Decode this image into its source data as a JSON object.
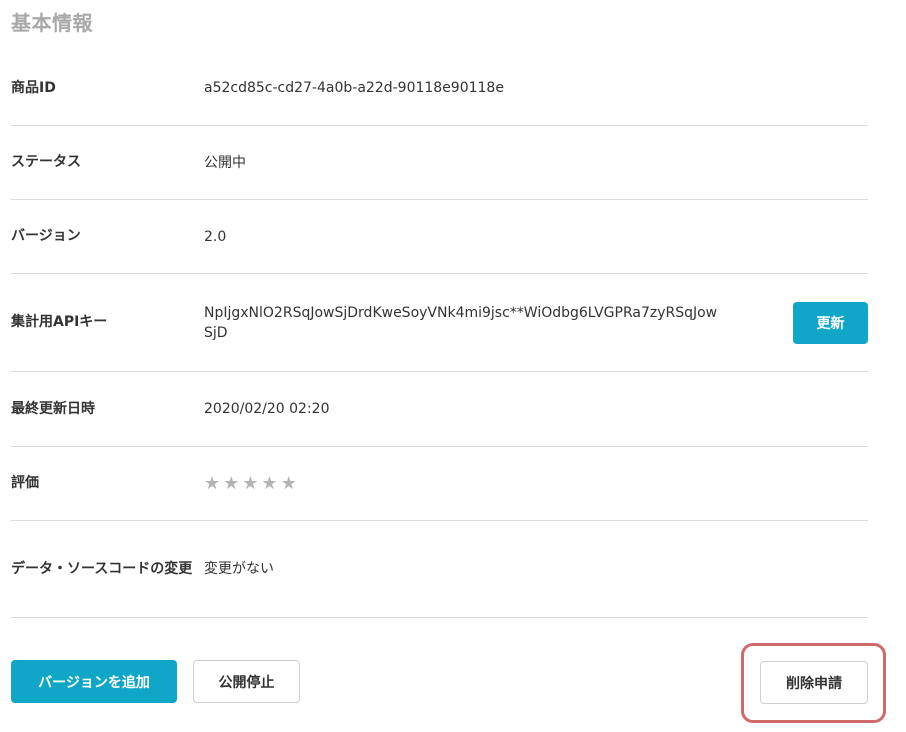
{
  "section_title": "基本情報",
  "rows": {
    "product_id": {
      "label": "商品ID",
      "value": "a52cd85c-cd27-4a0b-a22d-90118e90118e"
    },
    "status": {
      "label": "ステータス",
      "value": "公開中"
    },
    "version": {
      "label": "バージョン",
      "value": "2.0"
    },
    "api_key": {
      "label": "集計用APIキー",
      "value": "NpIjgxNlO2RSqJowSjDrdKweSoyVNk4mi9jsc**WiOdbg6LVGPRa7zyRSqJowSjD",
      "button": "更新"
    },
    "last_updated": {
      "label": "最終更新日時",
      "value": "2020/02/20 02:20"
    },
    "rating": {
      "label": "評価",
      "stars": [
        "★",
        "★",
        "★",
        "★",
        "★"
      ],
      "value": 0
    },
    "changes": {
      "label": "データ・ソースコードの変更",
      "value": "変更がない"
    }
  },
  "actions": {
    "add_version": "バージョンを追加",
    "unpublish": "公開停止",
    "delete_request": "削除申請"
  },
  "colors": {
    "accent": "#0fa6c8",
    "highlight": "#cf6a6a",
    "title": "#a8a8a8"
  }
}
